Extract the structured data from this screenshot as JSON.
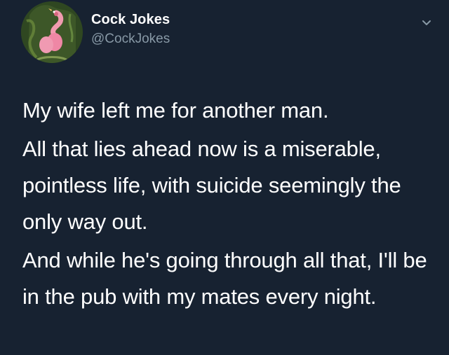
{
  "tweet": {
    "display_name": "Cock Jokes",
    "handle": "@CockJokes",
    "menu_icon": "chevron-down-icon",
    "avatar_icon": "avatar-image",
    "paragraphs": [
      "My wife left me for another man.",
      "All that lies ahead now is a miserable, pointless life, with suicide seemingly the only way out.",
      "And while he's going through all that, I'll be in the pub with my mates every night."
    ]
  },
  "colors": {
    "background": "#172231",
    "text": "#ffffff",
    "secondary_text": "#8899a6"
  }
}
